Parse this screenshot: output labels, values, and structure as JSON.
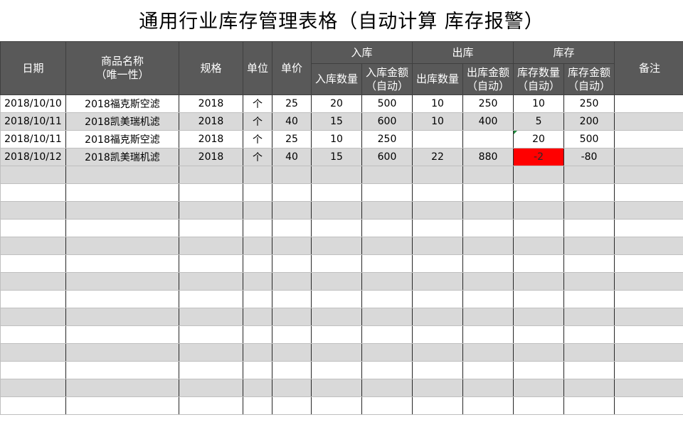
{
  "title": "通用行业库存管理表格（自动计算 库存报警）",
  "header": {
    "date": "日期",
    "product_line1": "商品名称",
    "product_line2": "（唯一性）",
    "spec": "规格",
    "unit": "单位",
    "price": "单价",
    "group_in": "入库",
    "group_out": "出库",
    "group_stock": "库存",
    "note": "备注",
    "in_qty": "入库数量",
    "in_amt_line1": "入库金额",
    "in_amt_line2": "（自动）",
    "out_qty": "出库数量",
    "out_amt_line1": "出库金额",
    "out_amt_line2": "（自动）",
    "stock_qty_line1": "库存数量",
    "stock_qty_line2": "（自动）",
    "stock_amt_line1": "库存金额",
    "stock_amt_line2": "（自动）"
  },
  "rows": [
    {
      "date": "2018/10/10",
      "product": "2018福克斯空滤",
      "spec": "2018",
      "unit": "个",
      "price": "25",
      "in_qty": "20",
      "in_amt": "500",
      "out_qty": "10",
      "out_amt": "250",
      "stock_qty": "10",
      "stock_amt": "250",
      "note": ""
    },
    {
      "date": "2018/10/11",
      "product": "2018凯美瑞机滤",
      "spec": "2018",
      "unit": "个",
      "price": "40",
      "in_qty": "15",
      "in_amt": "600",
      "out_qty": "10",
      "out_amt": "400",
      "stock_qty": "5",
      "stock_amt": "200",
      "note": ""
    },
    {
      "date": "2018/10/11",
      "product": "2018福克斯空滤",
      "spec": "2018",
      "unit": "个",
      "price": "25",
      "in_qty": "10",
      "in_amt": "250",
      "out_qty": "",
      "out_amt": "",
      "stock_qty": "20",
      "stock_amt": "500",
      "note": ""
    },
    {
      "date": "2018/10/12",
      "product": "2018凯美瑞机滤",
      "spec": "2018",
      "unit": "个",
      "price": "40",
      "in_qty": "15",
      "in_amt": "600",
      "out_qty": "22",
      "out_amt": "880",
      "stock_qty": "-2",
      "stock_amt": "-80",
      "note": ""
    }
  ],
  "colors": {
    "header_bg": "#595959",
    "header_text": "#ffffff",
    "band": "#d9d9d9",
    "alert": "#ff0000"
  }
}
